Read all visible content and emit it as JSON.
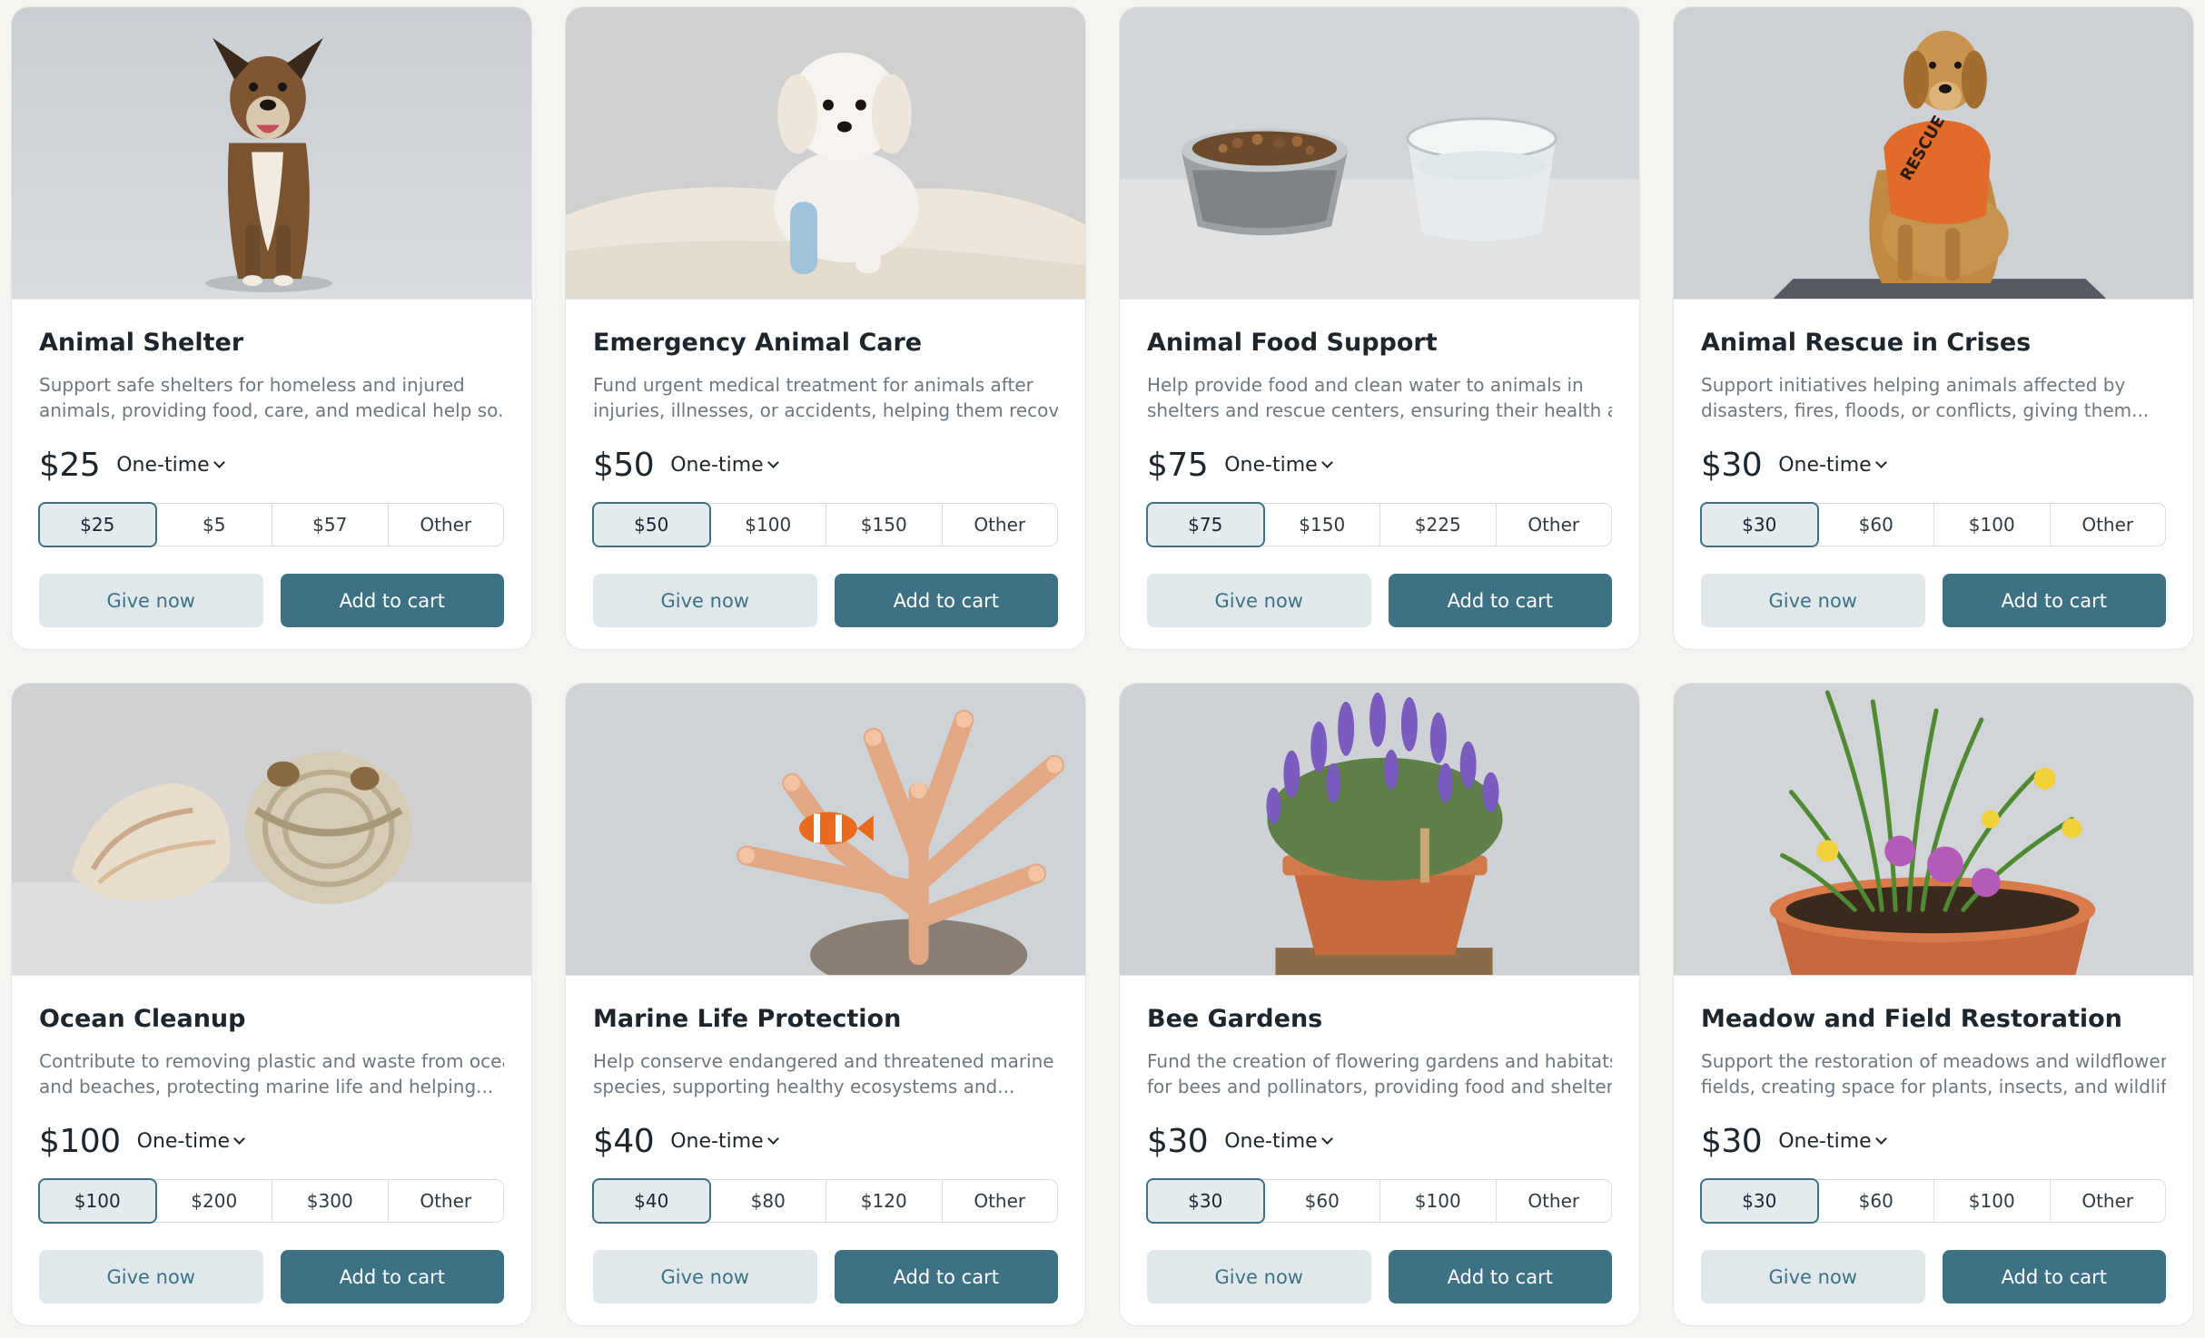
{
  "colors": {
    "accent": "#3d7285",
    "background": "#f4f4f1",
    "card": "#ffffff",
    "muted_text": "#6d7880"
  },
  "cards": [
    {
      "image": "dog-sitting-photo",
      "title": "Animal Shelter",
      "desc_line1": "Support safe shelters for homeless and injured",
      "desc_line2": "animals, providing food, care, and medical help so...",
      "price": "$25",
      "frequency": "One-time",
      "amounts": [
        "$25",
        "$5",
        "$57",
        "Other"
      ],
      "selected_amount": "$25",
      "give_label": "Give now",
      "cart_label": "Add to cart"
    },
    {
      "image": "white-puppy-bandaged-leg-photo",
      "title": "Emergency Animal Care",
      "desc_line1": "Fund urgent medical treatment for animals after",
      "desc_line2": "injuries, illnesses, or accidents, helping them recove...",
      "price": "$50",
      "frequency": "One-time",
      "amounts": [
        "$50",
        "$100",
        "$150",
        "Other"
      ],
      "selected_amount": "$50",
      "give_label": "Give now",
      "cart_label": "Add to cart"
    },
    {
      "image": "food-and-water-bowls-photo",
      "title": "Animal Food Support",
      "desc_line1": "Help provide food and clean water to animals in",
      "desc_line2": "shelters and rescue centers, ensuring their health an...",
      "price": "$75",
      "frequency": "One-time",
      "amounts": [
        "$75",
        "$150",
        "$225",
        "Other"
      ],
      "selected_amount": "$75",
      "give_label": "Give now",
      "cart_label": "Add to cart"
    },
    {
      "image": "rescue-dog-vest-photo",
      "title": "Animal Rescue in Crises",
      "desc_line1": "Support initiatives helping animals affected by",
      "desc_line2": "disasters, fires, floods, or conflicts, giving them...",
      "price": "$30",
      "frequency": "One-time",
      "amounts": [
        "$30",
        "$60",
        "$100",
        "Other"
      ],
      "selected_amount": "$30",
      "give_label": "Give now",
      "cart_label": "Add to cart",
      "vest_text": "RESCUE"
    },
    {
      "image": "seashell-and-rope-photo",
      "title": "Ocean Cleanup",
      "desc_line1": "Contribute to removing plastic and waste from oceans",
      "desc_line2": "and beaches, protecting marine life and helping...",
      "price": "$100",
      "frequency": "One-time",
      "amounts": [
        "$100",
        "$200",
        "$300",
        "Other"
      ],
      "selected_amount": "$100",
      "give_label": "Give now",
      "cart_label": "Add to cart"
    },
    {
      "image": "coral-and-clownfish-photo",
      "title": "Marine Life Protection",
      "desc_line1": "Help conserve endangered and threatened marine",
      "desc_line2": "species, supporting healthy ecosystems and...",
      "price": "$40",
      "frequency": "One-time",
      "amounts": [
        "$40",
        "$80",
        "$120",
        "Other"
      ],
      "selected_amount": "$40",
      "give_label": "Give now",
      "cart_label": "Add to cart"
    },
    {
      "image": "lavender-pot-photo",
      "title": "Bee Gardens",
      "desc_line1": "Fund the creation of flowering gardens and habitats",
      "desc_line2": "for bees and pollinators, providing food and shelter t...",
      "price": "$30",
      "frequency": "One-time",
      "amounts": [
        "$30",
        "$60",
        "$100",
        "Other"
      ],
      "selected_amount": "$30",
      "give_label": "Give now",
      "cart_label": "Add to cart"
    },
    {
      "image": "wildflower-pot-photo",
      "title": "Meadow and Field Restoration",
      "desc_line1": "Support the restoration of meadows and wildflower",
      "desc_line2": "fields, creating space for plants, insects, and wildlife...",
      "price": "$30",
      "frequency": "One-time",
      "amounts": [
        "$30",
        "$60",
        "$100",
        "Other"
      ],
      "selected_amount": "$30",
      "give_label": "Give now",
      "cart_label": "Add to cart"
    }
  ]
}
